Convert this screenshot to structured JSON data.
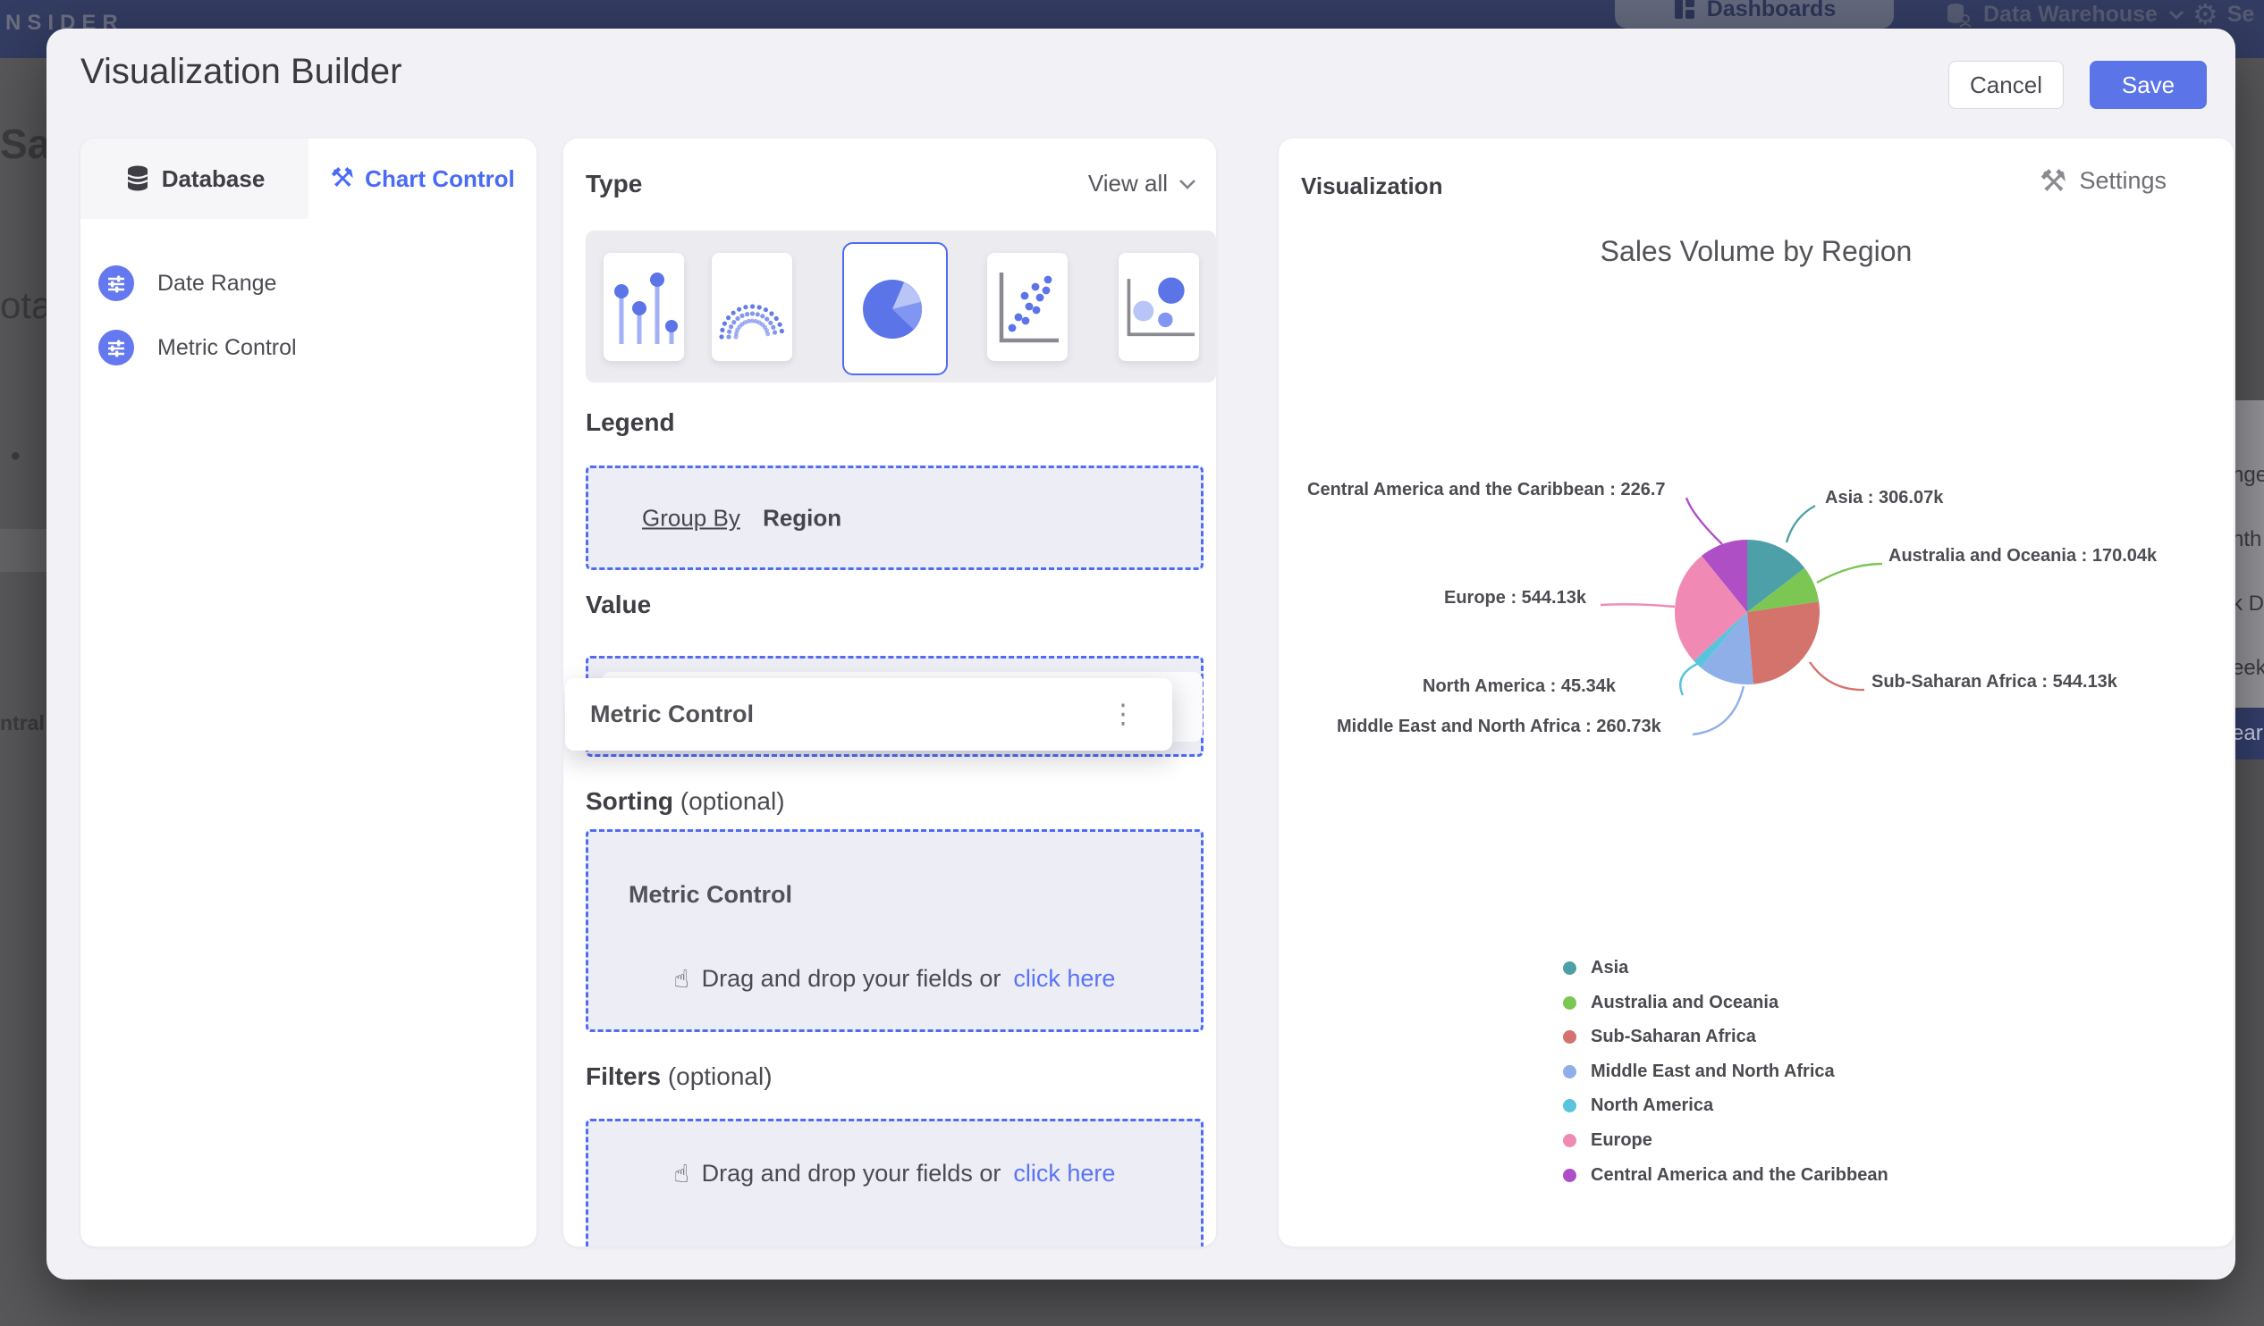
{
  "nav": {
    "logo": "NSIDER",
    "items": [
      {
        "label": "Dashboards",
        "active": true
      },
      {
        "label": "Data Warehouse",
        "active": false
      },
      {
        "label": "Se",
        "active": false
      }
    ]
  },
  "background": {
    "fragments_left": [
      "Sal",
      "ota",
      "ntral"
    ],
    "fragments_right": [
      "nge",
      "nth",
      "k D",
      "eek"
    ],
    "fragment_selected": "ear"
  },
  "modal": {
    "title": "Visualization Builder",
    "cancel_label": "Cancel",
    "save_label": "Save"
  },
  "sidebar": {
    "tabs": [
      {
        "label": "Database"
      },
      {
        "label": "Chart Control"
      }
    ],
    "items": [
      {
        "label": "Date Range"
      },
      {
        "label": "Metric Control"
      }
    ]
  },
  "builder": {
    "type_label": "Type",
    "view_all_label": "View all",
    "chart_types": [
      "lollipop",
      "arc-dots",
      "pie",
      "scatter",
      "bubble"
    ],
    "selected_type": "pie",
    "legend_label": "Legend",
    "group_by_label": "Group By",
    "group_by_value": "Region",
    "value_label": "Value",
    "value_chip": "Metric Control",
    "value_chip_ghost": "Metric Control",
    "sorting_label": "Sorting",
    "sorting_optional": "(optional)",
    "sorting_chip": "Metric Control",
    "filters_label": "Filters",
    "filters_optional": "(optional)",
    "dnd_text": "Drag and drop your fields or",
    "dnd_link_text": "click here"
  },
  "visualization": {
    "panel_title": "Visualization",
    "settings_label": "Settings"
  },
  "chart_data": {
    "type": "pie",
    "title": "Sales Volume by Region",
    "unit": "k",
    "legend_position": "bottom-left",
    "start_angle_deg": 0,
    "clockwise": true,
    "series": [
      {
        "name": "Asia",
        "value": 306.07,
        "color": "#4da0a8",
        "label": "Asia : 306.07k"
      },
      {
        "name": "Australia and Oceania",
        "value": 170.04,
        "color": "#7cc654",
        "label": "Australia and Oceania : 170.04k"
      },
      {
        "name": "Sub-Saharan Africa",
        "value": 544.13,
        "color": "#d4726c",
        "label": "Sub-Saharan Africa : 544.13k"
      },
      {
        "name": "Middle East and North Africa",
        "value": 260.73,
        "color": "#8fafe9",
        "label": "Middle East and North Africa : 260.73k"
      },
      {
        "name": "North America",
        "value": 45.34,
        "color": "#59c4dc",
        "label": "North America : 45.34k"
      },
      {
        "name": "Europe",
        "value": 544.13,
        "color": "#f08ab4",
        "label": "Europe : 544.13k"
      },
      {
        "name": "Central America and the Caribbean",
        "value": 226.77,
        "color": "#ae4fc5",
        "label": "Central America and the Caribbean : 226.7"
      }
    ],
    "accent_color": "#5b74e8"
  }
}
